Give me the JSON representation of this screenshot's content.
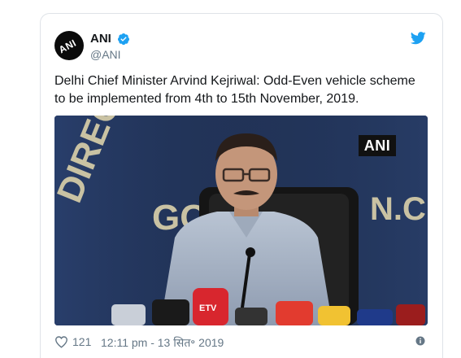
{
  "tweet": {
    "display_name": "ANI",
    "handle": "@ANI",
    "avatar_text": "ANI",
    "text": "Delhi Chief Minister Arvind Kejriwal: Odd-Even vehicle scheme to be implemented from 4th to 15th November, 2019.",
    "media": {
      "badge": "ANI",
      "backdrop_text_left": "DIREC",
      "backdrop_text_mid": "GO",
      "backdrop_text_right": "N.C",
      "mic_label": "ETV"
    },
    "likes": "121",
    "timestamp": "12:11 pm - 13 सित॰ 2019"
  },
  "colors": {
    "verified": "#1da1f2",
    "twitter_blue": "#1da1f2",
    "text": "#14171a",
    "muted": "#657786",
    "backdrop": "#23355a"
  },
  "icons": [
    "verified-badge-icon",
    "twitter-bird-icon",
    "heart-icon",
    "info-icon"
  ]
}
